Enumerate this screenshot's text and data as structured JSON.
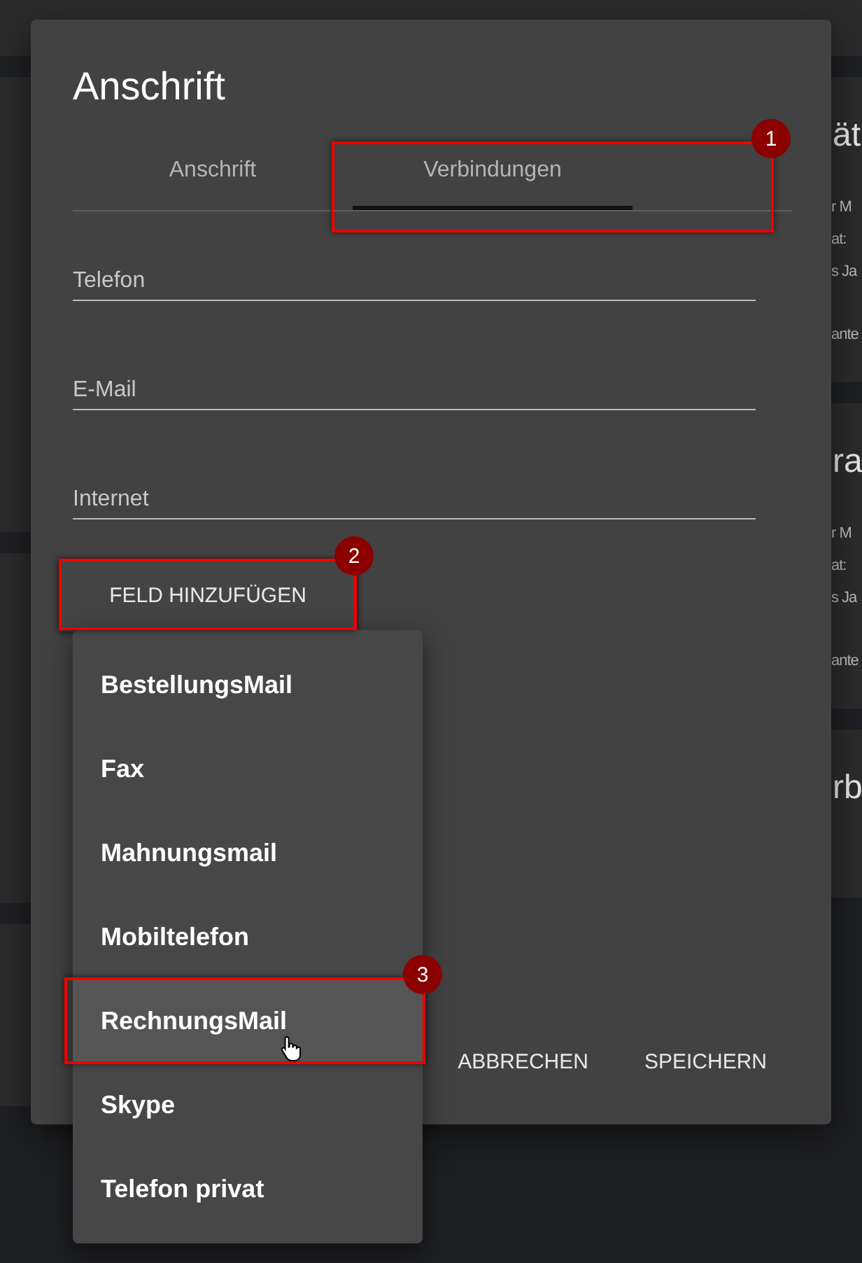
{
  "background_cards": [
    {
      "title": "ät",
      "lines": [
        "r M",
        "at:",
        "s Ja",
        "ante"
      ]
    },
    {
      "title": "ra",
      "lines": [
        "r M",
        "at:",
        "s Ja",
        "ante"
      ]
    },
    {
      "title": "rb"
    }
  ],
  "dialog": {
    "title": "Anschrift",
    "tabs": [
      {
        "label": "Anschrift",
        "selected": false
      },
      {
        "label": "Verbindungen",
        "selected": true
      }
    ],
    "fields": [
      {
        "placeholder": "Telefon"
      },
      {
        "placeholder": "E-Mail"
      },
      {
        "placeholder": "Internet"
      }
    ],
    "add_button": "FELD HINZUFÜGEN",
    "actions": [
      "ABBRECHEN",
      "SPEICHERN"
    ]
  },
  "menu": {
    "items": [
      {
        "label": "BestellungsMail",
        "highlighted": false
      },
      {
        "label": "Fax",
        "highlighted": false
      },
      {
        "label": "Mahnungsmail",
        "highlighted": false
      },
      {
        "label": "Mobiltelefon",
        "highlighted": false
      },
      {
        "label": "RechnungsMail",
        "highlighted": true
      },
      {
        "label": "Skype",
        "highlighted": false
      },
      {
        "label": "Telefon privat",
        "highlighted": false
      }
    ]
  },
  "annotations": [
    "1",
    "2",
    "3"
  ]
}
